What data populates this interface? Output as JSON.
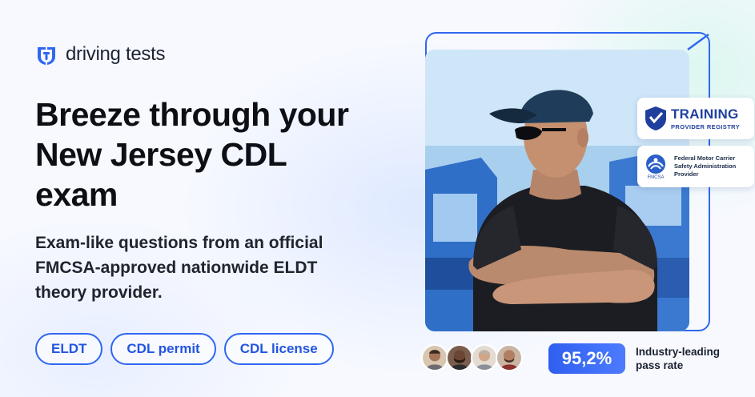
{
  "brand": {
    "name": "driving tests",
    "accent_color": "#2f67f0",
    "logo_icon": "driving-tests-logo-icon"
  },
  "hero": {
    "headline_line1": "Breeze through your",
    "headline_line2": "New Jersey CDL",
    "headline_line3": "exam",
    "sub_line1": "Exam-like questions from an official",
    "sub_line2": "FMCSA-approved nationwide ELDT",
    "sub_line3": "theory provider."
  },
  "tags": [
    {
      "label": "ELDT"
    },
    {
      "label": "CDL permit"
    },
    {
      "label": "CDL license"
    }
  ],
  "badges": {
    "training": {
      "title": "TRAINING",
      "subtitle": "PROVIDER REGISTRY",
      "icon": "shield-icon"
    },
    "fmcsa": {
      "logo_text": "FMCSA",
      "line1": "Federal Motor Carrier",
      "line2": "Safety Administration",
      "line3": "Provider",
      "icon": "fmcsa-logo-icon"
    }
  },
  "stats": {
    "pass_rate": "95,2%",
    "caption_line1": "Industry-leading",
    "caption_line2": "pass rate",
    "avatar_count": 4
  }
}
